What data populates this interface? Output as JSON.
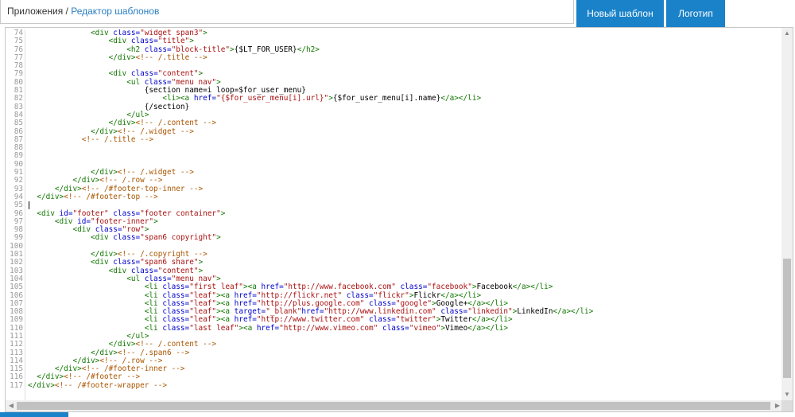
{
  "breadcrumb": {
    "parent": "Приложения",
    "separator": " / ",
    "current": "Редактор шаблонов"
  },
  "buttons": {
    "new_template": "Новый шаблон",
    "logotype": "Логотип"
  },
  "editor": {
    "lines": [
      {
        "n": "74",
        "tokens": [
          [
            "              ",
            ""
          ],
          [
            "<div ",
            "tag"
          ],
          [
            "class=",
            "attr"
          ],
          [
            "\"widget span3\"",
            "str"
          ],
          [
            ">",
            "tag"
          ]
        ]
      },
      {
        "n": "75",
        "tokens": [
          [
            "                  ",
            ""
          ],
          [
            "<div ",
            "tag"
          ],
          [
            "class=",
            "attr"
          ],
          [
            "\"title\"",
            "str"
          ],
          [
            ">",
            "tag"
          ]
        ]
      },
      {
        "n": "76",
        "tokens": [
          [
            "                      ",
            ""
          ],
          [
            "<h2 ",
            "tag"
          ],
          [
            "class=",
            "attr"
          ],
          [
            "\"block-title\"",
            "str"
          ],
          [
            ">",
            "tag"
          ],
          [
            "{$LT_FOR_USER}",
            "var"
          ],
          [
            "</h2>",
            "tag"
          ]
        ]
      },
      {
        "n": "77",
        "tokens": [
          [
            "                  ",
            ""
          ],
          [
            "</div>",
            "tag"
          ],
          [
            "<!-- /.title -->",
            "cmt"
          ]
        ]
      },
      {
        "n": "78",
        "tokens": []
      },
      {
        "n": "79",
        "tokens": [
          [
            "                  ",
            ""
          ],
          [
            "<div ",
            "tag"
          ],
          [
            "class=",
            "attr"
          ],
          [
            "\"content\"",
            "str"
          ],
          [
            ">",
            "tag"
          ]
        ]
      },
      {
        "n": "80",
        "tokens": [
          [
            "                      ",
            ""
          ],
          [
            "<ul ",
            "tag"
          ],
          [
            "class=",
            "attr"
          ],
          [
            "\"menu nav\"",
            "str"
          ],
          [
            ">",
            "tag"
          ]
        ]
      },
      {
        "n": "81",
        "tokens": [
          [
            "                          ",
            ""
          ],
          [
            "{section name=i loop=$for_user_menu}",
            "var"
          ]
        ]
      },
      {
        "n": "82",
        "tokens": [
          [
            "                              ",
            ""
          ],
          [
            "<li>",
            "tag"
          ],
          [
            "<a ",
            "tag"
          ],
          [
            "href=",
            "attr"
          ],
          [
            "\"{$for_user_menu[i].url}\"",
            "str"
          ],
          [
            ">",
            "tag"
          ],
          [
            "{$for_user_menu[i].name}",
            "var"
          ],
          [
            "</a>",
            "tag"
          ],
          [
            "</li>",
            "tag"
          ]
        ]
      },
      {
        "n": "83",
        "tokens": [
          [
            "                          ",
            ""
          ],
          [
            "{/section}",
            "var"
          ]
        ]
      },
      {
        "n": "84",
        "tokens": [
          [
            "                      ",
            ""
          ],
          [
            "</ul>",
            "tag"
          ]
        ]
      },
      {
        "n": "85",
        "tokens": [
          [
            "                  ",
            ""
          ],
          [
            "</div>",
            "tag"
          ],
          [
            "<!-- /.content -->",
            "cmt"
          ]
        ]
      },
      {
        "n": "86",
        "tokens": [
          [
            "              ",
            ""
          ],
          [
            "</div>",
            "tag"
          ],
          [
            "<!-- /.widget -->",
            "cmt"
          ]
        ]
      },
      {
        "n": "87",
        "tokens": [
          [
            "            ",
            ""
          ],
          [
            "<!-- /.title -->",
            "cmt"
          ]
        ]
      },
      {
        "n": "88",
        "tokens": []
      },
      {
        "n": "89",
        "tokens": []
      },
      {
        "n": "90",
        "tokens": []
      },
      {
        "n": "91",
        "tokens": [
          [
            "              ",
            ""
          ],
          [
            "</div>",
            "tag"
          ],
          [
            "<!-- /.widget -->",
            "cmt"
          ]
        ]
      },
      {
        "n": "92",
        "tokens": [
          [
            "          ",
            ""
          ],
          [
            "</div>",
            "tag"
          ],
          [
            "<!-- /.row -->",
            "cmt"
          ]
        ]
      },
      {
        "n": "93",
        "tokens": [
          [
            "      ",
            ""
          ],
          [
            "</div>",
            "tag"
          ],
          [
            "<!-- /#footer-top-inner -->",
            "cmt"
          ]
        ]
      },
      {
        "n": "94",
        "tokens": [
          [
            "  ",
            ""
          ],
          [
            "</div>",
            "tag"
          ],
          [
            "<!-- /#footer-top -->",
            "cmt"
          ]
        ]
      },
      {
        "n": "95",
        "tokens": [],
        "cursor": true
      },
      {
        "n": "96",
        "tokens": [
          [
            "  ",
            ""
          ],
          [
            "<div ",
            "tag"
          ],
          [
            "id=",
            "attr"
          ],
          [
            "\"footer\" ",
            "str"
          ],
          [
            "class=",
            "attr"
          ],
          [
            "\"footer container\"",
            "str"
          ],
          [
            ">",
            "tag"
          ]
        ]
      },
      {
        "n": "97",
        "tokens": [
          [
            "      ",
            ""
          ],
          [
            "<div ",
            "tag"
          ],
          [
            "id=",
            "attr"
          ],
          [
            "\"footer-inner\"",
            "str"
          ],
          [
            ">",
            "tag"
          ]
        ]
      },
      {
        "n": "98",
        "tokens": [
          [
            "          ",
            ""
          ],
          [
            "<div ",
            "tag"
          ],
          [
            "class=",
            "attr"
          ],
          [
            "\"row\"",
            "str"
          ],
          [
            ">",
            "tag"
          ]
        ]
      },
      {
        "n": "99",
        "tokens": [
          [
            "              ",
            ""
          ],
          [
            "<div ",
            "tag"
          ],
          [
            "class=",
            "attr"
          ],
          [
            "\"span6 copyright\"",
            "str"
          ],
          [
            ">",
            "tag"
          ]
        ]
      },
      {
        "n": "100",
        "tokens": []
      },
      {
        "n": "101",
        "tokens": [
          [
            "              ",
            ""
          ],
          [
            "</div>",
            "tag"
          ],
          [
            "<!-- /.copyright -->",
            "cmt"
          ]
        ]
      },
      {
        "n": "102",
        "tokens": [
          [
            "              ",
            ""
          ],
          [
            "<div ",
            "tag"
          ],
          [
            "class=",
            "attr"
          ],
          [
            "\"span6 share\"",
            "str"
          ],
          [
            ">",
            "tag"
          ]
        ]
      },
      {
        "n": "103",
        "tokens": [
          [
            "                  ",
            ""
          ],
          [
            "<div ",
            "tag"
          ],
          [
            "class=",
            "attr"
          ],
          [
            "\"content\"",
            "str"
          ],
          [
            ">",
            "tag"
          ]
        ]
      },
      {
        "n": "104",
        "tokens": [
          [
            "                      ",
            ""
          ],
          [
            "<ul ",
            "tag"
          ],
          [
            "class=",
            "attr"
          ],
          [
            "\"menu nav\"",
            "str"
          ],
          [
            ">",
            "tag"
          ]
        ]
      },
      {
        "n": "105",
        "tokens": [
          [
            "                          ",
            ""
          ],
          [
            "<li ",
            "tag"
          ],
          [
            "class=",
            "attr"
          ],
          [
            "\"first leaf\"",
            "str"
          ],
          [
            ">",
            "tag"
          ],
          [
            "<a ",
            "tag"
          ],
          [
            "href=",
            "attr"
          ],
          [
            "\"http://www.facebook.com\" ",
            "str"
          ],
          [
            "class=",
            "attr"
          ],
          [
            "\"facebook\"",
            "str"
          ],
          [
            ">",
            "tag"
          ],
          [
            "Facebook",
            "var"
          ],
          [
            "</a>",
            "tag"
          ],
          [
            "</li>",
            "tag"
          ]
        ]
      },
      {
        "n": "106",
        "tokens": [
          [
            "                          ",
            ""
          ],
          [
            "<li ",
            "tag"
          ],
          [
            "class=",
            "attr"
          ],
          [
            "\"leaf\"",
            "str"
          ],
          [
            ">",
            "tag"
          ],
          [
            "<a ",
            "tag"
          ],
          [
            "href=",
            "attr"
          ],
          [
            "\"http://flickr.net\" ",
            "str"
          ],
          [
            "class=",
            "attr"
          ],
          [
            "\"flickr\"",
            "str"
          ],
          [
            ">",
            "tag"
          ],
          [
            "Flickr",
            "var"
          ],
          [
            "</a>",
            "tag"
          ],
          [
            "</li>",
            "tag"
          ]
        ]
      },
      {
        "n": "107",
        "tokens": [
          [
            "                          ",
            ""
          ],
          [
            "<li ",
            "tag"
          ],
          [
            "class=",
            "attr"
          ],
          [
            "\"leaf\"",
            "str"
          ],
          [
            ">",
            "tag"
          ],
          [
            "<a ",
            "tag"
          ],
          [
            "href=",
            "attr"
          ],
          [
            "\"http://plus.google.com\" ",
            "str"
          ],
          [
            "class=",
            "attr"
          ],
          [
            "\"google\"",
            "str"
          ],
          [
            ">",
            "tag"
          ],
          [
            "Google+",
            "var"
          ],
          [
            "</a>",
            "tag"
          ],
          [
            "</li>",
            "tag"
          ]
        ]
      },
      {
        "n": "108",
        "tokens": [
          [
            "                          ",
            ""
          ],
          [
            "<li ",
            "tag"
          ],
          [
            "class=",
            "attr"
          ],
          [
            "\"leaf\"",
            "str"
          ],
          [
            ">",
            "tag"
          ],
          [
            "<a ",
            "tag"
          ],
          [
            "target=",
            "attr"
          ],
          [
            "\"_blank\"",
            "str"
          ],
          [
            "href=",
            "attr"
          ],
          [
            "\"http://www.linkedin.com\" ",
            "str"
          ],
          [
            "class=",
            "attr"
          ],
          [
            "\"linkedin\"",
            "str"
          ],
          [
            ">",
            "tag"
          ],
          [
            "LinkedIn",
            "var"
          ],
          [
            "</a>",
            "tag"
          ],
          [
            "</li>",
            "tag"
          ]
        ]
      },
      {
        "n": "109",
        "tokens": [
          [
            "                          ",
            ""
          ],
          [
            "<li ",
            "tag"
          ],
          [
            "class=",
            "attr"
          ],
          [
            "\"leaf\"",
            "str"
          ],
          [
            ">",
            "tag"
          ],
          [
            "<a ",
            "tag"
          ],
          [
            "href=",
            "attr"
          ],
          [
            "\"http://www.twitter.com\" ",
            "str"
          ],
          [
            "class=",
            "attr"
          ],
          [
            "\"twitter\"",
            "str"
          ],
          [
            ">",
            "tag"
          ],
          [
            "Twitter",
            "var"
          ],
          [
            "</a>",
            "tag"
          ],
          [
            "</li>",
            "tag"
          ]
        ]
      },
      {
        "n": "110",
        "tokens": [
          [
            "                          ",
            ""
          ],
          [
            "<li ",
            "tag"
          ],
          [
            "class=",
            "attr"
          ],
          [
            "\"last leaf\"",
            "str"
          ],
          [
            ">",
            "tag"
          ],
          [
            "<a ",
            "tag"
          ],
          [
            "href=",
            "attr"
          ],
          [
            "\"http://www.vimeo.com\" ",
            "str"
          ],
          [
            "class=",
            "attr"
          ],
          [
            "\"vimeo\"",
            "str"
          ],
          [
            ">",
            "tag"
          ],
          [
            "Vimeo",
            "var"
          ],
          [
            "</a>",
            "tag"
          ],
          [
            "</li>",
            "tag"
          ]
        ]
      },
      {
        "n": "111",
        "tokens": [
          [
            "                      ",
            ""
          ],
          [
            "</ul>",
            "tag"
          ]
        ]
      },
      {
        "n": "112",
        "tokens": [
          [
            "                  ",
            ""
          ],
          [
            "</div>",
            "tag"
          ],
          [
            "<!-- /.content -->",
            "cmt"
          ]
        ]
      },
      {
        "n": "113",
        "tokens": [
          [
            "              ",
            ""
          ],
          [
            "</div>",
            "tag"
          ],
          [
            "<!-- /.span6 -->",
            "cmt"
          ]
        ]
      },
      {
        "n": "114",
        "tokens": [
          [
            "          ",
            ""
          ],
          [
            "</div>",
            "tag"
          ],
          [
            "<!-- /.row -->",
            "cmt"
          ]
        ]
      },
      {
        "n": "115",
        "tokens": [
          [
            "      ",
            ""
          ],
          [
            "</div>",
            "tag"
          ],
          [
            "<!-- /#footer-inner -->",
            "cmt"
          ]
        ]
      },
      {
        "n": "116",
        "tokens": [
          [
            "  ",
            ""
          ],
          [
            "</div>",
            "tag"
          ],
          [
            "<!-- /#footer -->",
            "cmt"
          ]
        ]
      },
      {
        "n": "117",
        "tokens": [
          [
            "",
            ""
          ],
          [
            "</div>",
            "tag"
          ],
          [
            "<!-- /#footer-wrapper -->",
            "cmt"
          ]
        ]
      }
    ]
  },
  "colors": {
    "accent": "#1a82c8",
    "tag": "#117700",
    "attr": "#0000cc",
    "string": "#aa1111",
    "comment": "#aa5500"
  }
}
